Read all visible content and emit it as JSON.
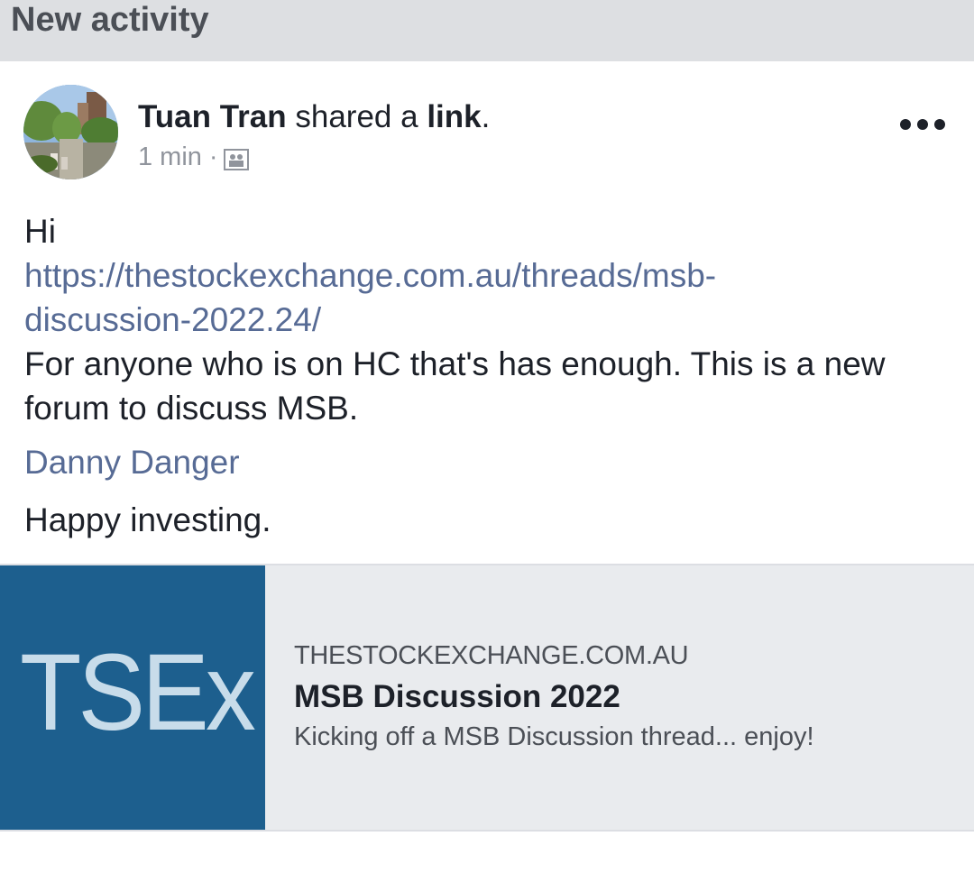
{
  "header": {
    "title": "New activity"
  },
  "post": {
    "author": "Tuan Tran",
    "action_text": " shared a ",
    "action_object": "link",
    "action_end": ".",
    "timestamp": "1 min",
    "meta_separator": "·",
    "audience_icon": "friends-icon",
    "more_icon": "more-options-icon",
    "body": {
      "greeting": "Hi",
      "url_line1": "https://thestockexchange.com.au/threads/msb-",
      "url_line2": "discussion-2022.24/",
      "text_line1": "For anyone who is on HC that's has enough. This is a new",
      "text_line2": "forum to discuss MSB."
    },
    "mention": "Danny Danger",
    "closing": "Happy investing.",
    "link_card": {
      "thumbnail_text": "TSEx",
      "domain": "THESTOCKEXCHANGE.COM.AU",
      "title": "MSB Discussion 2022",
      "description": "Kicking off a MSB Discussion thread... enjoy!"
    }
  },
  "colors": {
    "header_bg": "#dddfe2",
    "link": "#576b95",
    "text": "#1d2129",
    "secondary": "#90949c",
    "card_bg": "#e9ebee",
    "thumb_bg": "#1d5f8e"
  }
}
